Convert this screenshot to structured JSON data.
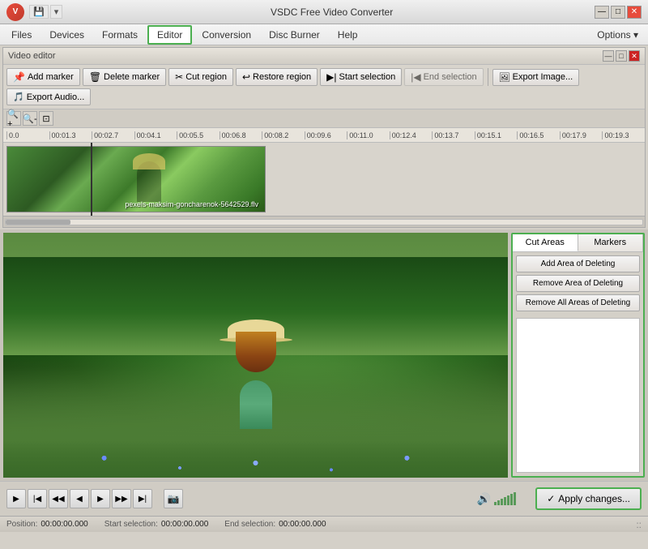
{
  "titlebar": {
    "title": "VSDC Free Video Converter",
    "icon_label": "V",
    "min_btn": "—",
    "max_btn": "□",
    "close_btn": "✕"
  },
  "menubar": {
    "items": [
      {
        "id": "files",
        "label": "Files"
      },
      {
        "id": "devices",
        "label": "Devices"
      },
      {
        "id": "formats",
        "label": "Formats"
      },
      {
        "id": "editor",
        "label": "Editor",
        "active": true
      },
      {
        "id": "conversion",
        "label": "Conversion"
      },
      {
        "id": "disc-burner",
        "label": "Disc Burner"
      },
      {
        "id": "help",
        "label": "Help"
      }
    ],
    "options_label": "Options ▾"
  },
  "video_editor": {
    "header_label": "Video editor",
    "toolbar": {
      "add_marker": "Add marker",
      "delete_marker": "Delete marker",
      "cut_region": "Cut region",
      "restore_region": "Restore region",
      "start_selection": "Start selection",
      "end_selection": "End selection",
      "export_image": "Export Image...",
      "export_audio": "Export Audio..."
    },
    "timeline": {
      "filename": "pexels-maksim-goncharenok-5642529.flv",
      "ruler_marks": [
        "0.0",
        "00:01.3",
        "00:02.7",
        "00:04.1",
        "00:05.5",
        "00:06.8",
        "00:08.2",
        "00:09.6",
        "00:11.0",
        "00:12.4",
        "00:13.7",
        "00:15.1",
        "00:16.5",
        "00:17.9",
        "00:19.3"
      ]
    }
  },
  "cut_areas": {
    "tabs": [
      {
        "id": "cut-areas",
        "label": "Cut Areas",
        "active": true
      },
      {
        "id": "markers",
        "label": "Markers"
      }
    ],
    "buttons": [
      {
        "id": "add-area",
        "label": "Add Area of Deleting"
      },
      {
        "id": "remove-area",
        "label": "Remove Area of Deleting"
      },
      {
        "id": "remove-all",
        "label": "Remove All Areas of Deleting"
      }
    ]
  },
  "controls": {
    "play": "▶",
    "prev_frame_start": "⏮",
    "prev_frame": "⏪",
    "prev": "◀",
    "next": "▶",
    "next_frame": "⏩",
    "next_frame_end": "⏭",
    "apply_changes": "Apply changes..."
  },
  "statusbar": {
    "position_label": "Position:",
    "position_value": "00:00:00.000",
    "start_label": "Start selection:",
    "start_value": "00:00:00.000",
    "end_label": "End selection:",
    "end_value": "00:00:00.000"
  }
}
